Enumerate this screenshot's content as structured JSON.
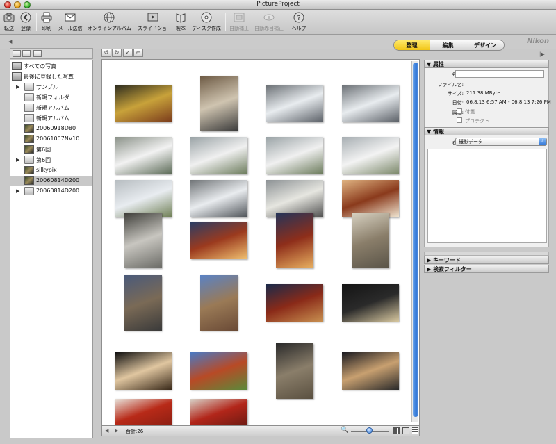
{
  "window": {
    "title": "PictureProject"
  },
  "toolbar": {
    "transfer": "転送",
    "register": "登録",
    "print": "印刷",
    "mail": "メール送信",
    "online_album": "オンラインアルバム",
    "slideshow": "スライドショー",
    "book": "製本",
    "disc": "ディスク作成",
    "auto_enhance": "自動補正",
    "auto_redeye": "自動赤目補正",
    "help": "ヘルプ"
  },
  "mode_tabs": [
    "整理",
    "編集",
    "デザイン"
  ],
  "brand": "Nikon",
  "tree": [
    {
      "label": "すべての写真",
      "icon": "all-photos-icon"
    },
    {
      "label": "最後に登録した写真",
      "icon": "recent-photos-icon"
    },
    {
      "label": "サンプル",
      "icon": "folder-icon",
      "expandable": true
    },
    {
      "label": "新規フォルダ",
      "icon": "folder-icon"
    },
    {
      "label": "新規アルバム",
      "icon": "album-icon"
    },
    {
      "label": "新規アルバム",
      "icon": "album-icon"
    },
    {
      "label": "20060918D80",
      "icon": "album-thumb-icon"
    },
    {
      "label": "20061007NV10",
      "icon": "album-thumb-icon"
    },
    {
      "label": "第6回",
      "icon": "album-thumb-icon"
    },
    {
      "label": "第6回",
      "icon": "folder-icon",
      "expandable": true
    },
    {
      "label": "silkypix",
      "icon": "album-thumb-icon"
    },
    {
      "label": "20060814D200",
      "icon": "album-thumb-icon",
      "selected": true
    },
    {
      "label": "20060814D200",
      "icon": "folder-icon",
      "expandable": true
    }
  ],
  "status": {
    "count": "合計:26"
  },
  "properties": {
    "header": "属性",
    "name_label": "名前:",
    "name_value": "",
    "filename_label": "ファイル名:",
    "filename_value": "",
    "size_label": "サイズ:",
    "size_value": "211.38 MByte",
    "date_label": "日付:",
    "date_value": "06.8.13 6:57 AM - 06.8.13 7:26 PM",
    "attr_label": "属性:",
    "attr_options": [
      "付箋",
      "プロテクト"
    ]
  },
  "info": {
    "header": "情報",
    "display_label": "表示:",
    "display_value": "撮影データ"
  },
  "sections": {
    "keyword": "キーワード",
    "search_filter": "検索フィルター"
  },
  "thumbnails": [
    {
      "subject": "station-interior",
      "colors": [
        "#2a2a1e",
        "#c8a23a",
        "#7a3b1c"
      ]
    },
    {
      "subject": "escalator-building",
      "colors": [
        "#6d5a44",
        "#cfc4b0",
        "#3a3a3a"
      ]
    },
    {
      "subject": "airplane-gate",
      "colors": [
        "#6a6f74",
        "#e8ecef",
        "#5a5f66"
      ]
    },
    {
      "subject": "airplane-gate",
      "colors": [
        "#6a6f74",
        "#e8ecef",
        "#5a5f66"
      ]
    },
    {
      "subject": "jal-airplane",
      "colors": [
        "#8a9188",
        "#f2f2f2",
        "#5b6a56"
      ]
    },
    {
      "subject": "airplane-runway",
      "colors": [
        "#9aa3a6",
        "#f0f0f0",
        "#6a7a5a"
      ]
    },
    {
      "subject": "airplane-runway",
      "colors": [
        "#9aa3a6",
        "#f0f0f0",
        "#6a7a5a"
      ]
    },
    {
      "subject": "airplanes-apron",
      "colors": [
        "#a7aeb2",
        "#f3f3f3",
        "#7a8769"
      ]
    },
    {
      "subject": "ana-airplane",
      "colors": [
        "#b6bcc0",
        "#e8ecf0",
        "#6f7f55"
      ]
    },
    {
      "subject": "airplane-gate",
      "colors": [
        "#707477",
        "#e9ecef",
        "#4e5358"
      ]
    },
    {
      "subject": "airplane-front",
      "colors": [
        "#8c9194",
        "#e6e6e0",
        "#4f4f4f"
      ]
    },
    {
      "subject": "shisa-mask",
      "colors": [
        "#e0b482",
        "#8a3a1c",
        "#f0e6d2"
      ]
    },
    {
      "subject": "monorail-station",
      "colors": [
        "#3d3d38",
        "#c8c6c0",
        "#6b6b66"
      ]
    },
    {
      "subject": "shuri-gate",
      "colors": [
        "#2a3e66",
        "#9b3a1e",
        "#f0c070"
      ]
    },
    {
      "subject": "shuri-gate-night",
      "colors": [
        "#23345a",
        "#8e2e1a",
        "#e8b060"
      ]
    },
    {
      "subject": "stone-gate",
      "colors": [
        "#d8d2c2",
        "#8a7e6a",
        "#5a5448"
      ]
    },
    {
      "subject": "castle-wall",
      "colors": [
        "#4a5a7a",
        "#7a6a56",
        "#3a3a3a"
      ]
    },
    {
      "subject": "castle-wall-sky",
      "colors": [
        "#5a82c4",
        "#9a7a56",
        "#6a4a36"
      ]
    },
    {
      "subject": "red-gate-night",
      "colors": [
        "#1a2a4a",
        "#8a2a18",
        "#c89050"
      ]
    },
    {
      "subject": "gate-silhouette",
      "colors": [
        "#141414",
        "#2a2a2a",
        "#d8c8a0"
      ]
    },
    {
      "subject": "sunset-rooftop",
      "colors": [
        "#0e0e0e",
        "#e0c6a0",
        "#3a2a1a"
      ]
    },
    {
      "subject": "red-hall",
      "colors": [
        "#4a7ac4",
        "#b84a26",
        "#5a8a3a"
      ]
    },
    {
      "subject": "stone-arch-night",
      "colors": [
        "#2a2a2a",
        "#8a7e6a",
        "#5a5040"
      ]
    },
    {
      "subject": "palm-sunset",
      "colors": [
        "#1a1a20",
        "#c8a070",
        "#2a2a2a"
      ]
    },
    {
      "subject": "shurijo-hall",
      "colors": [
        "#e8e4dc",
        "#b82a18",
        "#8a1e12"
      ]
    },
    {
      "subject": "shurijo-hall-red",
      "colors": [
        "#d8d2c8",
        "#b2261a",
        "#6a1a12"
      ]
    }
  ]
}
